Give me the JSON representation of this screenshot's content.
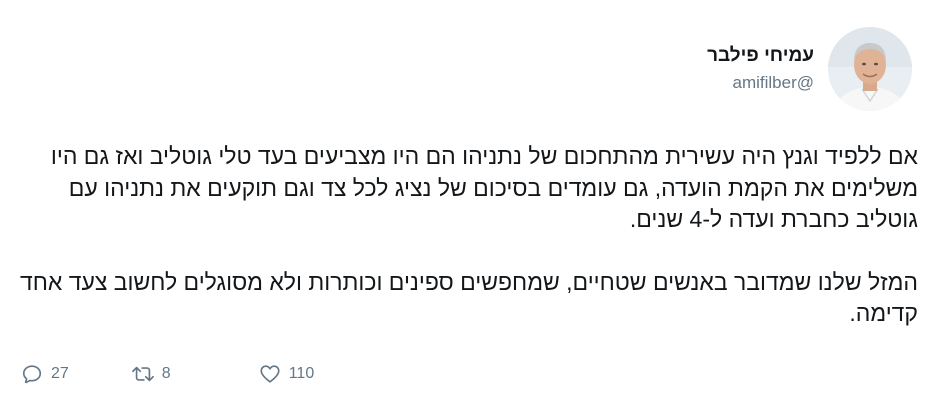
{
  "author": {
    "display_name": "עמיחי פילבר",
    "handle": "amifilber@"
  },
  "tweet": {
    "paragraph_1": "אם ללפיד וגנץ היה עשירית מהתחכום של נתניהו הם היו מצביעים בעד טלי גוטליב ואז גם היו משלימים את הקמת הועדה, גם עומדים בסיכום של נציג לכל צד וגם תוקעים את נתניהו עם גוטליב כחברת ועדה ל-4 שנים.",
    "paragraph_2": "המזל שלנו שמדובר באנשים שטחיים, שמחפשים ספינים וכותרות ולא מסוגלים לחשוב צעד אחד קדימה."
  },
  "actions": {
    "reply": {
      "icon": "reply-icon",
      "count": "27"
    },
    "retweet": {
      "icon": "retweet-icon",
      "count": "8"
    },
    "like": {
      "icon": "heart-icon",
      "count": "110"
    }
  },
  "colors": {
    "text": "#14171a",
    "secondary": "#657786"
  }
}
